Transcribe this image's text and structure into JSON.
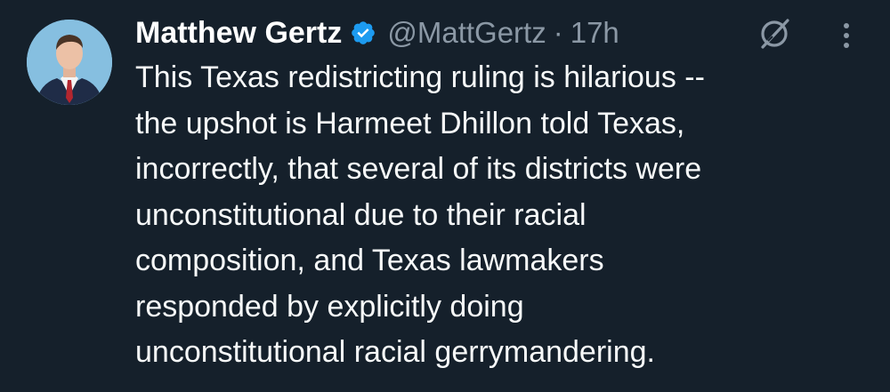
{
  "tweet": {
    "display_name": "Matthew Gertz",
    "handle": "@MattGertz",
    "separator": "·",
    "time": "17h",
    "verified": true,
    "text": "This Texas redistricting ruling is hilarious --\nthe upshot is Harmeet Dhillon told Texas,\nincorrectly, that several of its districts were\nunconstitutional due to their racial\ncomposition, and Texas lawmakers\nresponded by explicitly doing\nunconstitutional racial gerrymandering."
  },
  "icons": {
    "verified": "verified-badge-icon",
    "grok": "grok-icon",
    "more": "more-options-icon"
  },
  "colors": {
    "background": "#15202b",
    "text_primary": "#ffffff",
    "text_secondary": "#8b98a5",
    "verified_blue": "#1d9bf0"
  }
}
